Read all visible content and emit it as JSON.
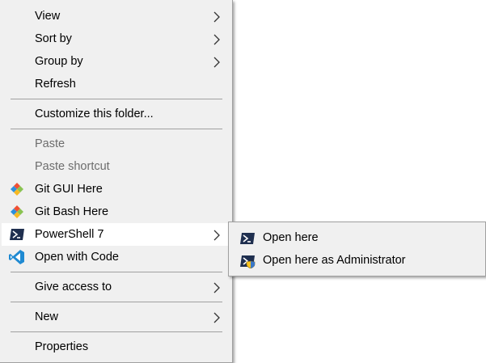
{
  "context_menu": {
    "items": {
      "view": {
        "label": "View",
        "has_submenu": true
      },
      "sort_by": {
        "label": "Sort by",
        "has_submenu": true
      },
      "group_by": {
        "label": "Group by",
        "has_submenu": true
      },
      "refresh": {
        "label": "Refresh"
      },
      "customize": {
        "label": "Customize this folder..."
      },
      "paste": {
        "label": "Paste",
        "disabled": true
      },
      "paste_shortcut": {
        "label": "Paste shortcut",
        "disabled": true
      },
      "git_gui": {
        "label": "Git GUI Here",
        "icon": "git-icon"
      },
      "git_bash": {
        "label": "Git Bash Here",
        "icon": "git-icon"
      },
      "powershell": {
        "label": "PowerShell 7",
        "icon": "powershell-icon",
        "has_submenu": true,
        "highlighted": true
      },
      "open_code": {
        "label": "Open with Code",
        "icon": "vscode-icon"
      },
      "give_access": {
        "label": "Give access to",
        "has_submenu": true
      },
      "new": {
        "label": "New",
        "has_submenu": true
      },
      "properties": {
        "label": "Properties"
      }
    }
  },
  "powershell_submenu": {
    "items": {
      "open_here": {
        "label": "Open here",
        "icon": "powershell-icon"
      },
      "open_here_admin": {
        "label": "Open here as Administrator",
        "icon": "powershell-admin-icon"
      }
    }
  },
  "colors": {
    "menu_background": "#f0f0f0",
    "highlight_background": "#ffffff",
    "disabled_text": "#6d6d6d",
    "separator": "#a0a0a0",
    "powershell_icon": "#1f2f4f",
    "vscode_icon": "#1f8ad2",
    "git_icon_red": "#f05033"
  }
}
